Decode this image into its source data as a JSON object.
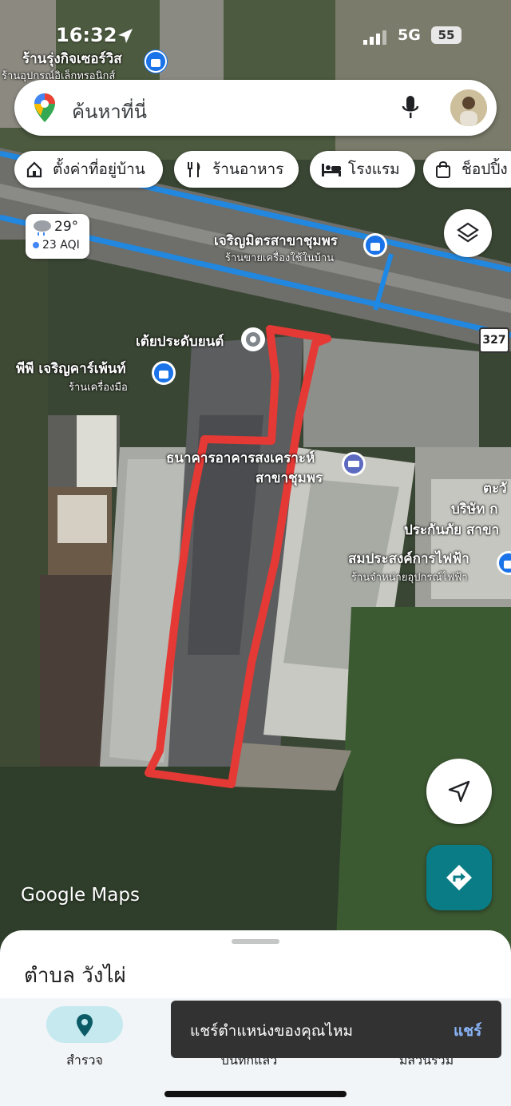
{
  "status": {
    "time": "16:32",
    "network": "5G",
    "battery": "55"
  },
  "search": {
    "placeholder": "ค้นหาที่นี่"
  },
  "chips": [
    {
      "label": "ตั้งค่าที่อยู่บ้าน",
      "icon": "home-icon"
    },
    {
      "label": "ร้านอาหาร",
      "icon": "restaurant-icon"
    },
    {
      "label": "โรงแรม",
      "icon": "hotel-icon"
    },
    {
      "label": "ช็อปปิ้ง",
      "icon": "shopping-icon"
    }
  ],
  "weather": {
    "temp": "29°",
    "aqi": "23 AQI"
  },
  "map_labels": {
    "poi1_name": "ร้านรุ่งกิจเซอร์วิส",
    "poi1_sub": "ร้านอุปกรณ์อิเล็กทรอนิกส์",
    "poi2_name": "เจริญมิตรสาขาชุมพร",
    "poi2_sub": "ร้านขายเครื่องใช้ในบ้าน",
    "road_number": "327",
    "poi3_name": "เต้ยประดับยนต์",
    "poi4_name": "พีพี เจริญคาร์เพ้นท์",
    "poi4_sub": "ร้านเครื่องมือ",
    "poi5_name_line1": "ธนาคารอาคารสงเคราะห์",
    "poi5_name_line2": "สาขาชุมพร",
    "poi6_line1": "ตะวั",
    "poi6_line2": "บริษัท ก",
    "poi6_line3": "ประกันภัย สาขา",
    "poi7_name": "สมประสงค์การไฟฟ้า",
    "poi7_sub": "ร้านจำหน่ายอุปกรณ์ไฟฟ้า",
    "watermark": "Google Maps"
  },
  "sheet": {
    "title": "ตำบล วังไผ่"
  },
  "nav": {
    "explore": "สำรวจ",
    "saved": "บันทึกแล้ว",
    "contribute": "มีส่วนร่วม"
  },
  "snackbar": {
    "message": "แชร์ตำแหน่งของคุณไหม",
    "action": "แชร์"
  },
  "colors": {
    "accent": "#0a7c86",
    "route": "#1e88e5",
    "highlight": "#e53935"
  }
}
